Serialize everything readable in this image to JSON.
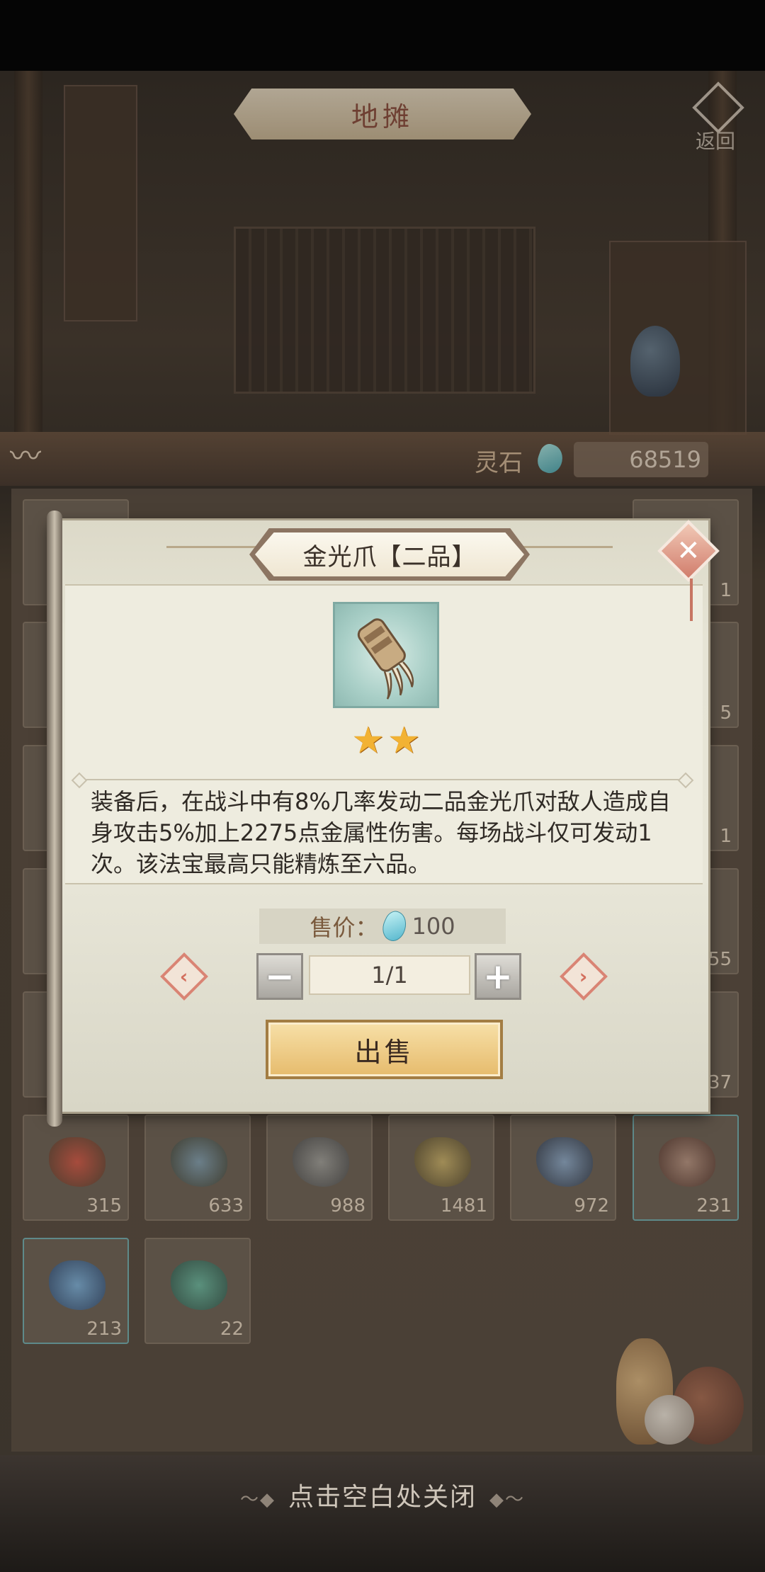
{
  "header": {
    "title": "地摊",
    "return_label": "返回"
  },
  "currency": {
    "label": "灵石",
    "amount": "68519",
    "icon": "spirit-stone-icon"
  },
  "inventory": {
    "visible_counts": [
      {
        "count": "1"
      },
      {
        "count": "5"
      },
      {
        "count": "1"
      },
      {
        "count": "55"
      },
      {
        "count": "37"
      },
      {
        "count": "315"
      },
      {
        "count": "633"
      },
      {
        "count": "988"
      },
      {
        "count": "1481"
      },
      {
        "count": "972"
      },
      {
        "count": "231"
      },
      {
        "count": "213"
      },
      {
        "count": "22"
      }
    ]
  },
  "modal": {
    "title": "金光爪【二品】",
    "item_icon": "golden-claw-icon",
    "stars": 2,
    "description": "装备后，在战斗中有8%几率发动二品金光爪对敌人造成自身攻击5%加上2275点金属性伤害。每场战斗仅可发动1次。该法宝最高只能精炼至六品。",
    "price_label": "售价：",
    "price_value": "100",
    "quantity": "1/1",
    "sell_label": "出售",
    "close_icon": "close-icon"
  },
  "footer": {
    "hint": "点击空白处关闭"
  },
  "colors": {
    "star": "#f2b233",
    "sell_button": "#e6bb6c",
    "accent_red": "#d36f5e"
  }
}
